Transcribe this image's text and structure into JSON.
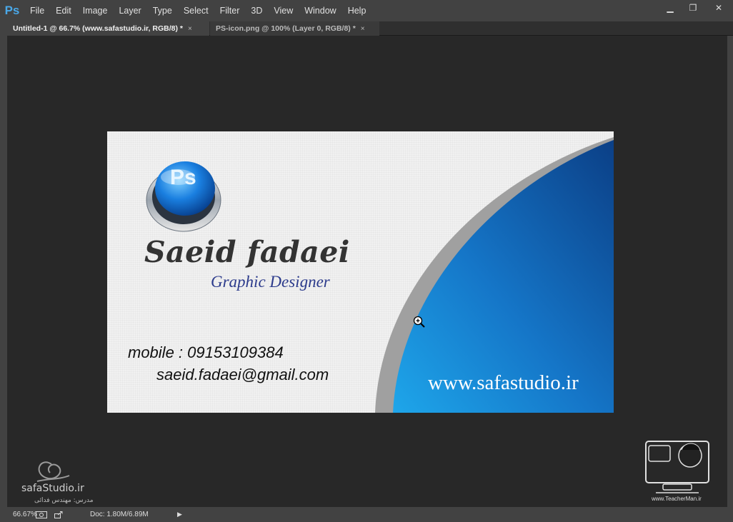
{
  "app": {
    "logo": "Ps"
  },
  "menu": [
    "File",
    "Edit",
    "Image",
    "Layer",
    "Type",
    "Select",
    "Filter",
    "3D",
    "View",
    "Window",
    "Help"
  ],
  "window_controls": {
    "minimize": "▁",
    "restore": "❐",
    "close": "✕"
  },
  "tabs": [
    {
      "label": "Untitled-1 @ 66.7% (www.safastudio.ir, RGB/8) *",
      "active": true
    },
    {
      "label": "PS-icon.png @ 100% (Layer 0, RGB/8) *",
      "active": false
    }
  ],
  "tab_close_glyph": "×",
  "card": {
    "name": "Saeid fadaei",
    "role": "Graphic Designer",
    "mobile": "mobile : 09153109384",
    "email": "saeid.fadaei@gmail.com",
    "website": "www.safastudio.ir",
    "logo_text": "Ps",
    "colors": {
      "blue_dark": "#0b3f86",
      "blue_light": "#1ea6ea",
      "gray_band": "#a0a0a0"
    }
  },
  "watermark_left": {
    "brand": "safaStudio.ir",
    "subtitle": "مدرس: مهندس فدائی"
  },
  "watermark_right": {
    "brand": "www.TeacherMan.ir"
  },
  "status": {
    "zoom": "66.67%",
    "doc": "Doc: 1.80M/6.89M",
    "arrow": "▶"
  }
}
